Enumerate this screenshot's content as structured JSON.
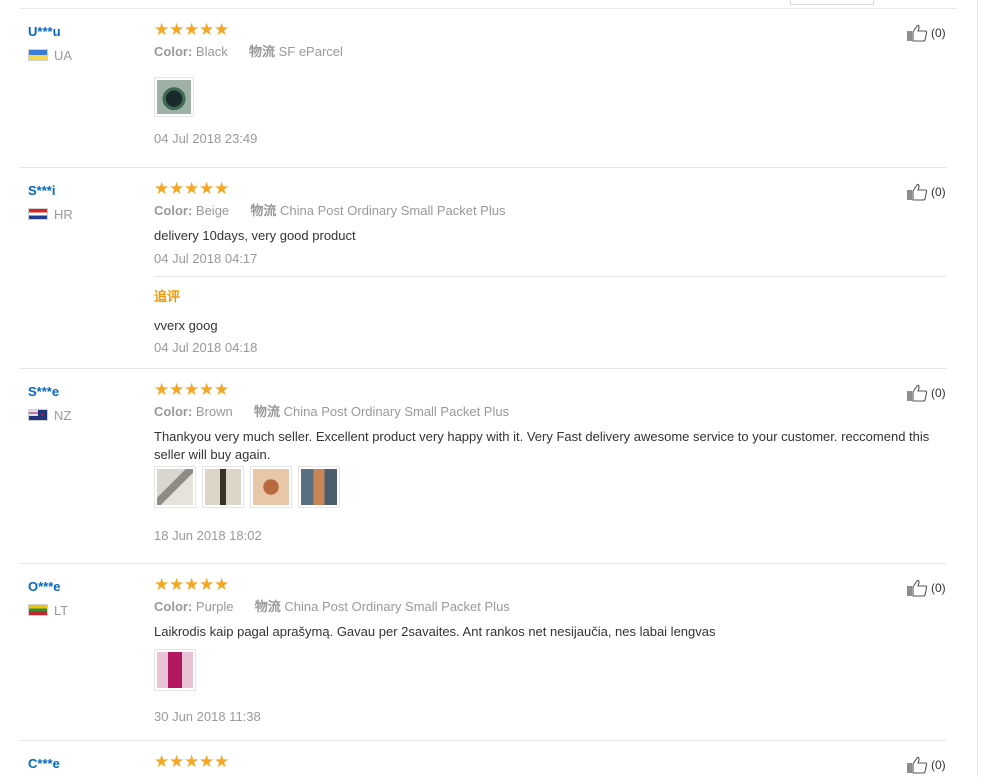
{
  "colors": {
    "user_link": "#0067c4",
    "star": "#f5a623",
    "muted": "#999999",
    "append_title": "#f39800"
  },
  "icons": {
    "rating": "star-icon",
    "helpful": "thumbs-up-icon"
  },
  "feedback": [
    {
      "user": "U***u",
      "country": "UA",
      "rating": 5,
      "color_label": "Color:",
      "color_value": "Black",
      "logistics_label": "物流",
      "logistics_value": "SF eParcel",
      "text": "",
      "photos": 1,
      "date": "04 Jul 2018 23:49",
      "helpful": "(0)"
    },
    {
      "user": "S***i",
      "country": "HR",
      "rating": 5,
      "color_label": "Color:",
      "color_value": "Beige",
      "logistics_label": "物流",
      "logistics_value": "China Post Ordinary Small Packet Plus",
      "text": "delivery 10days, very good product",
      "photos": 0,
      "date": "04 Jul 2018 04:17",
      "helpful": "(0)",
      "append": {
        "title": "追评",
        "text": "vverx goog",
        "date": "04 Jul 2018 04:18"
      }
    },
    {
      "user": "S***e",
      "country": "NZ",
      "rating": 5,
      "color_label": "Color:",
      "color_value": "Brown",
      "logistics_label": "物流",
      "logistics_value": "China Post Ordinary Small Packet Plus",
      "text": "Thankyou very much seller. Excellent product very happy with it. Very Fast delivery awesome service to your customer. reccomend this seller will buy again.",
      "photos": 4,
      "date": "18 Jun 2018 18:02",
      "helpful": "(0)"
    },
    {
      "user": "O***e",
      "country": "LT",
      "rating": 5,
      "color_label": "Color:",
      "color_value": "Purple",
      "logistics_label": "物流",
      "logistics_value": "China Post Ordinary Small Packet Plus",
      "text": "Laikrodis kaip pagal aprašymą. Gavau per 2savaites. Ant rankos net nesijaučia, nes labai lengvas",
      "photos": 1,
      "date": "30 Jun 2018 11:38",
      "helpful": "(0)"
    },
    {
      "user": "C***e",
      "rating": 5,
      "helpful": "(0)"
    }
  ]
}
